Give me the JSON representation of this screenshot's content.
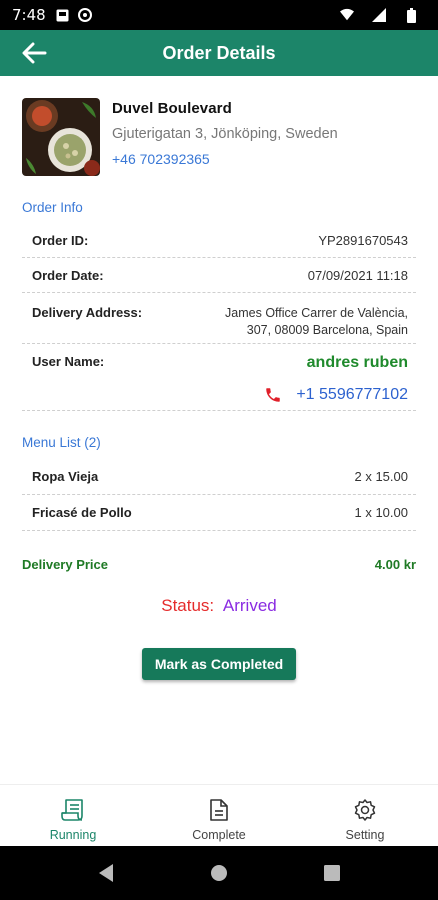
{
  "status_bar": {
    "time": "7:48"
  },
  "app_bar": {
    "title": "Order Details"
  },
  "restaurant": {
    "name": "Duvel Boulevard",
    "address": "Gjuterigatan 3, Jönköping, Sweden",
    "phone": "+46 702392365"
  },
  "order_info": {
    "title": "Order Info",
    "id_label": "Order ID:",
    "id_value": "YP2891670543",
    "date_label": "Order Date:",
    "date_value": "07/09/2021 11:18",
    "address_label": "Delivery Address:",
    "address_line1": "James Office Carrer de València,",
    "address_line2": "307, 08009 Barcelona, Spain",
    "user_label": "User Name:",
    "user_name": "andres ruben",
    "user_phone": "+1 5596777102"
  },
  "menu": {
    "title": "Menu List (2)",
    "items": [
      {
        "name": "Ropa Vieja",
        "qty_price": "2 x 15.00"
      },
      {
        "name": "Fricasé de Pollo",
        "qty_price": "1 x 10.00"
      }
    ]
  },
  "delivery": {
    "label": "Delivery Price",
    "value": "4.00 kr"
  },
  "status": {
    "label": "Status:",
    "value": "Arrived"
  },
  "action": {
    "complete_label": "Mark as Completed"
  },
  "bottom_nav": {
    "items": [
      {
        "label": "Running",
        "icon": "receipt-icon",
        "active": true
      },
      {
        "label": "Complete",
        "icon": "document-icon",
        "active": false
      },
      {
        "label": "Setting",
        "icon": "gear-icon",
        "active": false
      }
    ]
  },
  "colors": {
    "primary": "#1c8569",
    "link_blue": "#3a78d6",
    "user_green": "#1f8a2c",
    "status_red": "#e52b2b",
    "status_purple": "#8a2be2"
  }
}
